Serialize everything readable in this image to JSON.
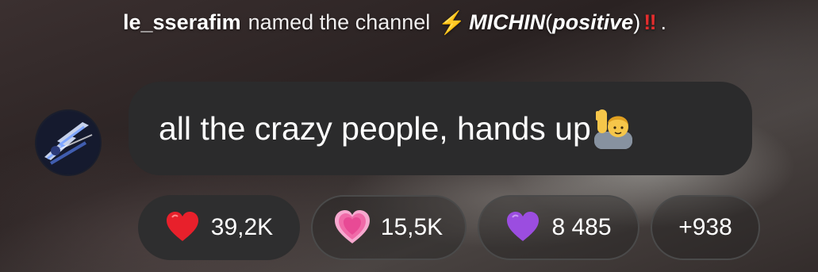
{
  "system_message": {
    "username": "le_sserafim",
    "action_text": "named the channel",
    "bolt_emoji": "⚡",
    "channel_name_part1": "MICHIN",
    "channel_name_paren_open": "(",
    "channel_name_part2": "positive",
    "channel_name_paren_close": ")",
    "bang_emoji": "‼",
    "trailing": "."
  },
  "message": {
    "text": "all the crazy people, hands up",
    "emoji": "person-raising-hand-emoji"
  },
  "reactions": [
    {
      "emoji": "red-heart-emoji",
      "count": "39,2K",
      "active": true
    },
    {
      "emoji": "growing-heart-emoji",
      "count": "15,5K",
      "active": false
    },
    {
      "emoji": "purple-heart-emoji",
      "count": "8 485",
      "active": false
    }
  ],
  "more_reactions": "+938",
  "colors": {
    "bubble_bg": "#2b2b2c",
    "bolt": "#f2c230",
    "bang": "#e32d2d",
    "heart_red": "#e8202b",
    "heart_pink": "#f06aa8",
    "heart_purple": "#9b4de0"
  }
}
